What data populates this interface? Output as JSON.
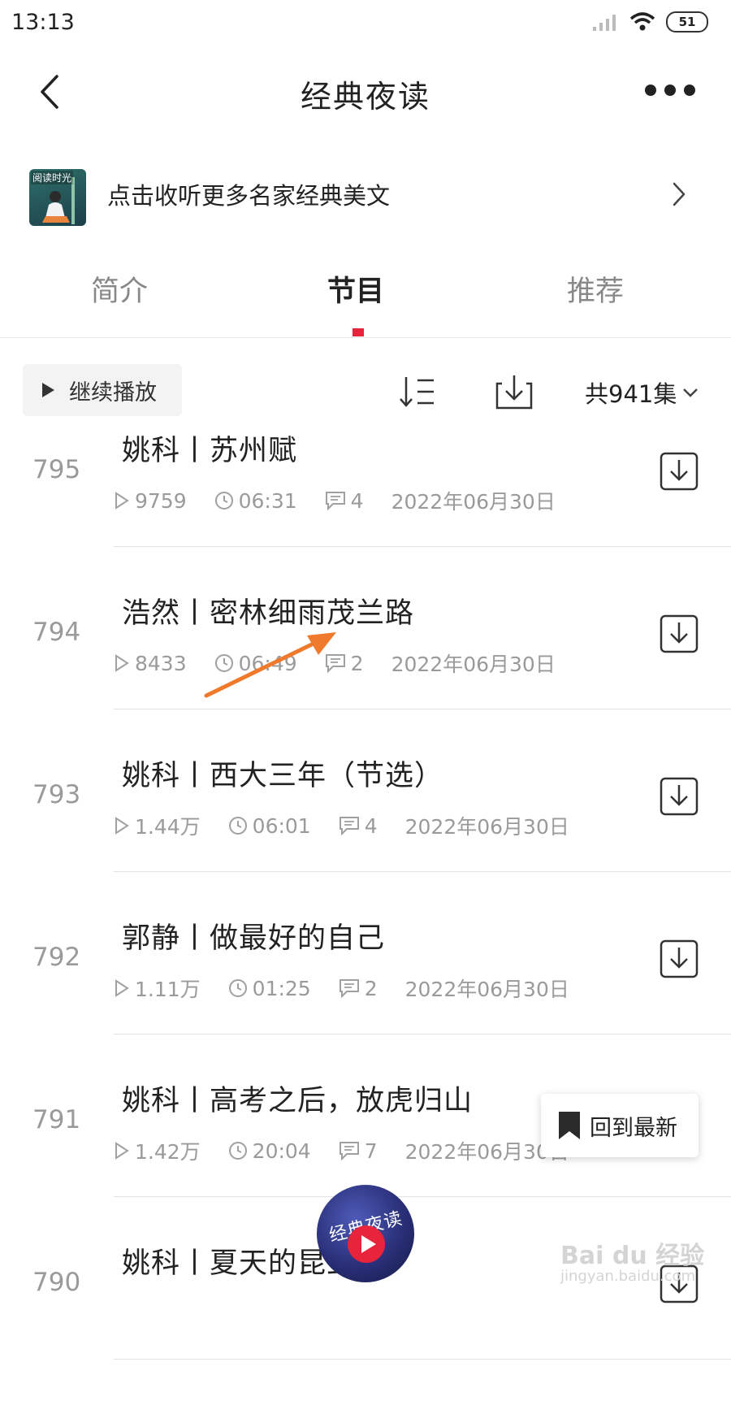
{
  "status_bar": {
    "time": "13:13",
    "battery": "51"
  },
  "header": {
    "title": "经典夜读"
  },
  "promo": {
    "text": "点击收听更多名家经典美文",
    "cover_label": "阅读时光"
  },
  "tabs": [
    {
      "label": "简介",
      "active": false
    },
    {
      "label": "节目",
      "active": true
    },
    {
      "label": "推荐",
      "active": false
    }
  ],
  "toolbar": {
    "continue_label": "继续播放",
    "count_label": "共941集"
  },
  "episodes": [
    {
      "num": "795",
      "title": "姚科丨苏州赋",
      "plays": "9759",
      "duration": "06:31",
      "comments": "4",
      "date": "2022年06月30日"
    },
    {
      "num": "794",
      "title": "浩然丨密林细雨茂兰路",
      "plays": "8433",
      "duration": "06:49",
      "comments": "2",
      "date": "2022年06月30日"
    },
    {
      "num": "793",
      "title": "姚科丨西大三年（节选）",
      "plays": "1.44万",
      "duration": "06:01",
      "comments": "4",
      "date": "2022年06月30日"
    },
    {
      "num": "792",
      "title": "郭静丨做最好的自己",
      "plays": "1.11万",
      "duration": "01:25",
      "comments": "2",
      "date": "2022年06月30日"
    },
    {
      "num": "791",
      "title": "姚科丨高考之后，放虎归山",
      "plays": "1.42万",
      "duration": "20:04",
      "comments": "7",
      "date": "2022年06月30日"
    },
    {
      "num": "790",
      "title": "姚科丨夏天的昆虫"
    }
  ],
  "back_to_latest": {
    "label": "回到最新"
  },
  "mini_player": {
    "cover_text": "经典夜读"
  },
  "watermark": {
    "brand": "Bai du 经验",
    "url": "jingyan.baidu.com"
  },
  "colors": {
    "accent": "#e8243c",
    "annotation_arrow": "#f07a2c",
    "muted_text": "#9a9a9a"
  }
}
